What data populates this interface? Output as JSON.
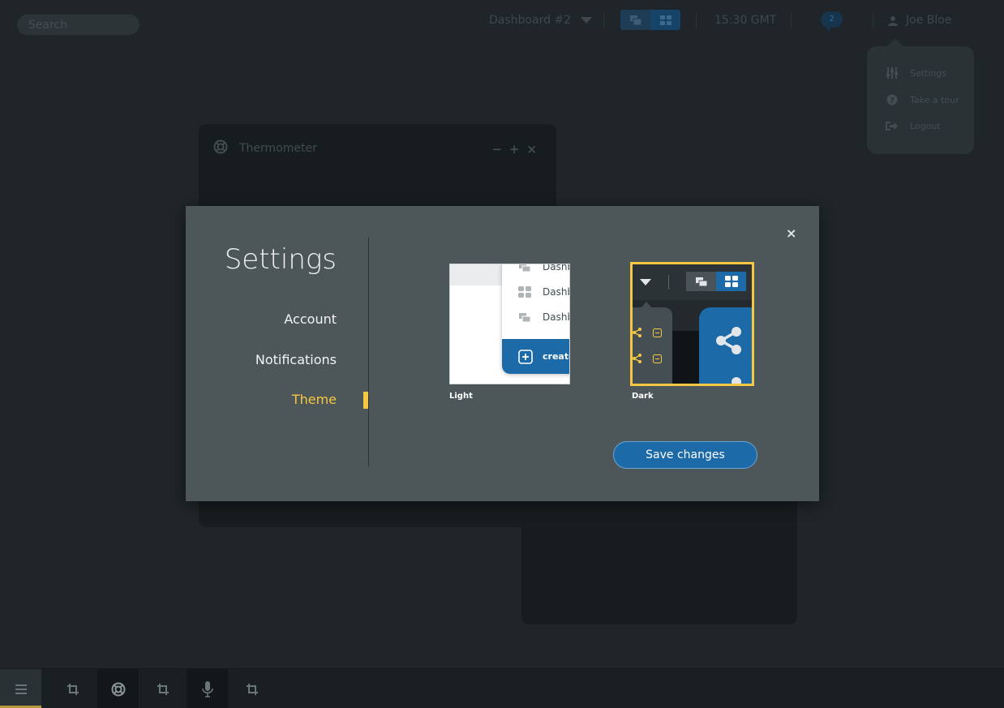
{
  "topbar": {
    "search_placeholder": "Search",
    "dashboard_label": "Dashboard #2",
    "time": "15:30 GMT",
    "chat_count": "2",
    "user_name": "Joe Bloe"
  },
  "user_menu": {
    "items": [
      {
        "label": "Settings",
        "icon": "sliders-icon"
      },
      {
        "label": "Take a tour",
        "icon": "question-icon"
      },
      {
        "label": "Logout",
        "icon": "logout-icon"
      }
    ]
  },
  "widget": {
    "title": "Thermometer",
    "controls": [
      "−",
      "+",
      "×"
    ]
  },
  "settings": {
    "title": "Settings",
    "nav": [
      "Account",
      "Notifications",
      "Theme"
    ],
    "active_nav": "Theme",
    "close_glyph": "×",
    "themes": [
      {
        "label": "Light",
        "selected": false
      },
      {
        "label": "Dark",
        "selected": true
      }
    ],
    "light_preview": {
      "rows": [
        "Dashb",
        "Dashb",
        "Dashb"
      ],
      "create_label": "create"
    },
    "save_label": "Save changes"
  },
  "colors": {
    "accent": "#f4c843",
    "primary": "#1c6aa8",
    "modal_bg": "#4d5659",
    "page_bg": "#1f2528"
  },
  "bottombar": {
    "items": [
      "menu-icon",
      "crop-icon",
      "lifebuoy-icon",
      "crop-icon",
      "microphone-icon",
      "crop-icon"
    ]
  }
}
